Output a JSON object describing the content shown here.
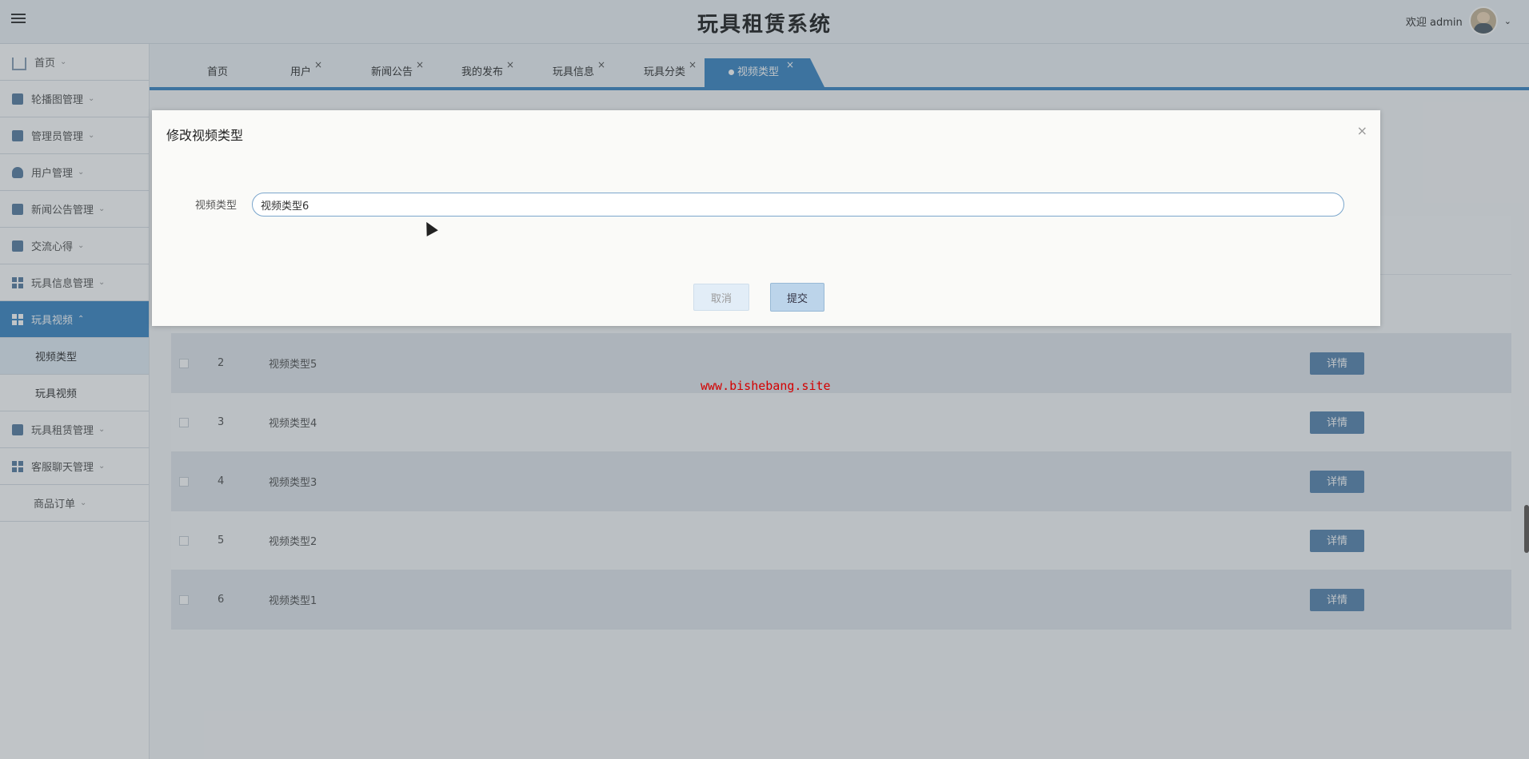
{
  "app": {
    "title": "玩具租赁系统"
  },
  "user": {
    "greeting": "欢迎 admin"
  },
  "sidebar": {
    "items": [
      {
        "label": "首页"
      },
      {
        "label": "轮播图管理"
      },
      {
        "label": "管理员管理"
      },
      {
        "label": "用户管理"
      },
      {
        "label": "新闻公告管理"
      },
      {
        "label": "交流心得"
      },
      {
        "label": "玩具信息管理"
      },
      {
        "label": "玩具视频"
      },
      {
        "label": "玩具租赁管理"
      },
      {
        "label": "客服聊天管理"
      },
      {
        "label": "商品订单"
      }
    ],
    "sub_items": [
      {
        "label": "视频类型"
      },
      {
        "label": "玩具视频"
      }
    ]
  },
  "tabs": [
    {
      "label": "首页"
    },
    {
      "label": "用户"
    },
    {
      "label": "新闻公告"
    },
    {
      "label": "我的发布"
    },
    {
      "label": "玩具信息"
    },
    {
      "label": "玩具分类"
    },
    {
      "label": "视频类型"
    }
  ],
  "table": {
    "rows": [
      {
        "index": "2",
        "name": "视频类型5",
        "action": "详情"
      },
      {
        "index": "3",
        "name": "视频类型4",
        "action": "详情"
      },
      {
        "index": "4",
        "name": "视频类型3",
        "action": "详情"
      },
      {
        "index": "5",
        "name": "视频类型2",
        "action": "详情"
      },
      {
        "index": "6",
        "name": "视频类型1",
        "action": "详情"
      }
    ]
  },
  "watermark": "www.bishebang.site",
  "modal": {
    "title": "修改视频类型",
    "field_label": "视频类型",
    "field_value": "视频类型6",
    "cancel_label": "取消",
    "submit_label": "提交"
  },
  "colors": {
    "accent": "#3f88c5",
    "detail_button": "#5a87b0",
    "watermark": "#d40000"
  }
}
